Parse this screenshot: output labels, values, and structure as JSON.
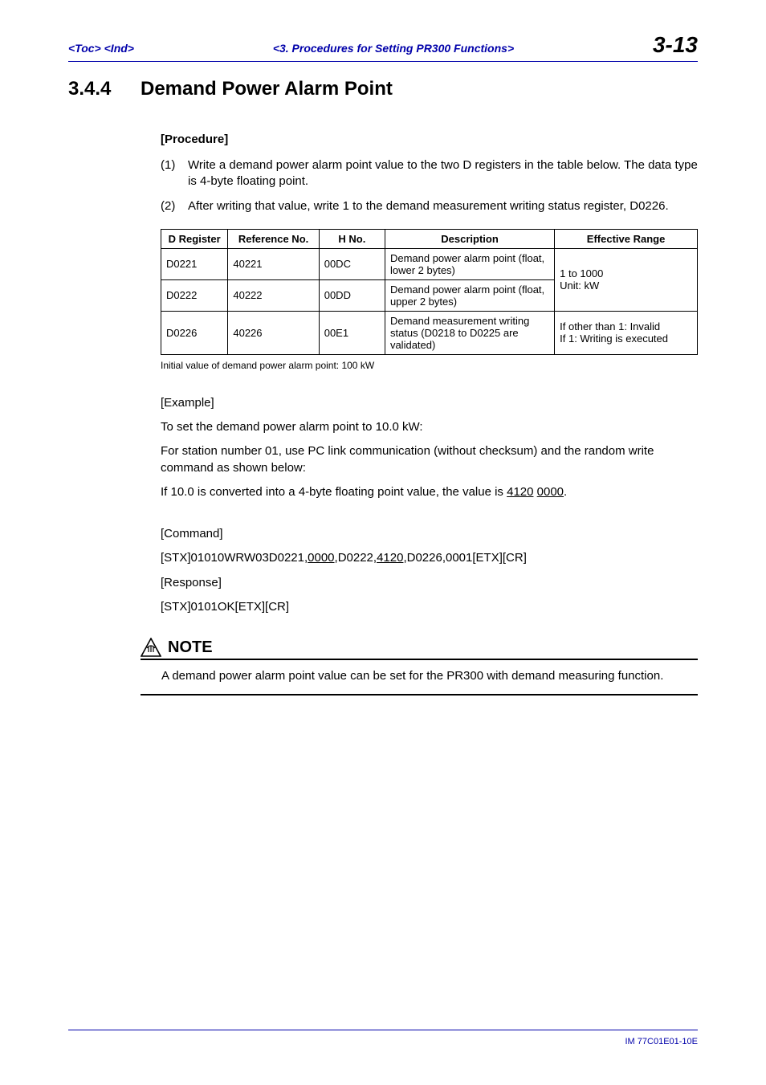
{
  "header": {
    "toc": "<Toc>",
    "ind": "<Ind>",
    "center": "<3.  Procedures for Setting PR300 Functions>",
    "pageNum": "3-13"
  },
  "title": {
    "secNum": "3.4.4",
    "text": "Demand Power Alarm Point"
  },
  "procedure": {
    "label": "[Procedure]",
    "items": [
      {
        "num": "(1)",
        "text": "Write a demand power alarm point value to the two D registers in the table below. The data type is 4-byte floating point."
      },
      {
        "num": "(2)",
        "text": "After writing that value, write 1 to the demand measurement writing status register, D0226."
      }
    ]
  },
  "table": {
    "headers": {
      "dreg": "D Register",
      "ref": "Reference No.",
      "hno": "H No.",
      "desc": "Description",
      "range": "Effective Range"
    },
    "rows": [
      {
        "dreg": "D0221",
        "ref": "40221",
        "hno": "00DC",
        "desc": "Demand power alarm point (float, lower 2 bytes)"
      },
      {
        "dreg": "D0222",
        "ref": "40222",
        "hno": "00DD",
        "desc": "Demand power alarm point (float, upper 2 bytes)"
      },
      {
        "dreg": "D0226",
        "ref": "40226",
        "hno": "00E1",
        "desc": "Demand measurement writing status (D0218 to D0225 are validated)"
      }
    ],
    "rangeTop_line1": "1 to 1000",
    "rangeTop_line2": "Unit: kW",
    "rangeBottom_line1": "If other than 1: Invalid",
    "rangeBottom_line2": "If 1: Writing is executed",
    "footnote": "Initial value of demand power alarm point: 100 kW"
  },
  "example": {
    "label": "[Example]",
    "line1": "To set the demand power alarm point to 10.0 kW:",
    "line2": "For station number 01, use PC link communication (without checksum) and the random write command as shown below:",
    "line3_pre": "If 10.0 is converted into a 4-byte floating point value, the value is ",
    "line3_u1": "4120",
    "line3_mid": " ",
    "line3_u2": "0000",
    "line3_post": "."
  },
  "command": {
    "label": "[Command]",
    "p1": "[STX]01010WRW03D0221,",
    "u1": "0000",
    "p2": ",D0222,",
    "u2": "4120",
    "p3": ",D0226,0001[ETX][CR]",
    "respLabel": "[Response]",
    "respLine": "[STX]0101OK[ETX][CR]"
  },
  "note": {
    "title": "NOTE",
    "body": "A demand power alarm point value can be set for the PR300 with demand measuring function."
  },
  "footer": {
    "doc": "IM 77C01E01-10E"
  }
}
